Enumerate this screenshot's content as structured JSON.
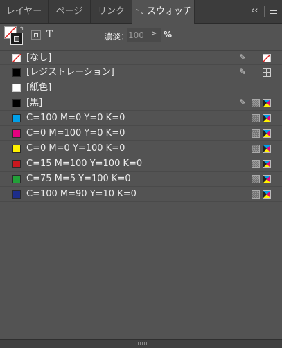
{
  "tabs": [
    {
      "label": "レイヤー"
    },
    {
      "label": "ページ"
    },
    {
      "label": "リンク"
    },
    {
      "label": "スウォッチ",
      "arrows": "⌃⌄"
    }
  ],
  "panel_controls": {
    "collapse": "‹‹"
  },
  "toolbar": {
    "text_button": "T",
    "tint_label": "濃淡：",
    "tint_value": "100",
    "tint_arrow": ">",
    "percent": "%"
  },
  "swatches": [
    {
      "name": "[なし]",
      "color": "none",
      "locked": true,
      "type": "none"
    },
    {
      "name": "[レジストレーション]",
      "color": "#000000",
      "locked": true,
      "type": "registration"
    },
    {
      "name": "[紙色]",
      "color": "#ffffff",
      "locked": false,
      "type": "paper"
    },
    {
      "name": "[黒]",
      "color": "#000000",
      "locked": true,
      "type": "process"
    },
    {
      "name": "C=100 M=0 Y=0 K=0",
      "color": "#00a0e9",
      "locked": false,
      "type": "process"
    },
    {
      "name": "C=0 M=100 Y=0 K=0",
      "color": "#e4007f",
      "locked": false,
      "type": "process"
    },
    {
      "name": "C=0 M=0 Y=100 K=0",
      "color": "#fff100",
      "locked": false,
      "type": "process"
    },
    {
      "name": "C=15 M=100 Y=100 K=0",
      "color": "#c9171e",
      "locked": false,
      "type": "process"
    },
    {
      "name": "C=75 M=5 Y=100 K=0",
      "color": "#22a038",
      "locked": false,
      "type": "process"
    },
    {
      "name": "C=100 M=90 Y=10 K=0",
      "color": "#1d2d8a",
      "locked": false,
      "type": "process"
    }
  ],
  "colors": {
    "panel_bg": "#535353",
    "tab_bg": "#3c3c3c"
  }
}
